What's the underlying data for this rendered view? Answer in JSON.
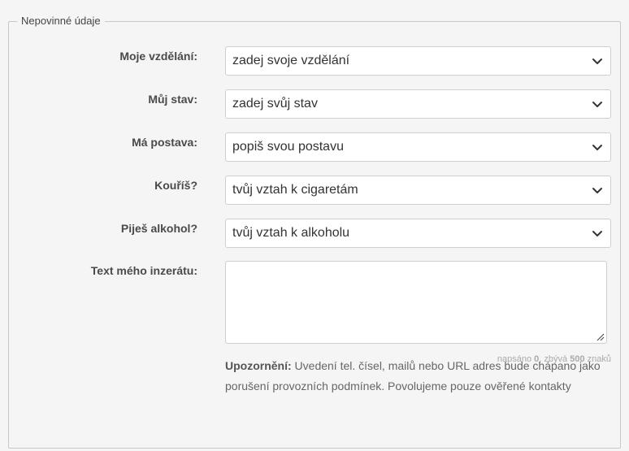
{
  "fieldset": {
    "legend": "Nepovinné údaje"
  },
  "rows": [
    {
      "label": "Moje vzdělání:",
      "value": "zadej svoje vzdělání"
    },
    {
      "label": "Můj stav:",
      "value": "zadej svůj stav"
    },
    {
      "label": "Má postava:",
      "value": "popiš svou postavu"
    },
    {
      "label": "Kouříš?",
      "value": "tvůj vztah k cigaretám"
    },
    {
      "label": "Piješ alkohol?",
      "value": "tvůj vztah k alkoholu"
    }
  ],
  "ad_text": {
    "label": "Text mého inzerátu:",
    "value": ""
  },
  "counter": {
    "written_label": "napsáno",
    "written": "0",
    "remaining_label": ", zbývá",
    "remaining": "500",
    "unit": "znaků"
  },
  "notice": {
    "title": "Upozornění:",
    "text": "Uvedení tel. čísel, mailů nebo URL adres bude chápano jako porušení provozních podmínek. Povolujeme pouze ověřené kontakty"
  },
  "icons": {
    "dropdown": "chevron-down-icon",
    "resize": "resize-grip-icon"
  }
}
